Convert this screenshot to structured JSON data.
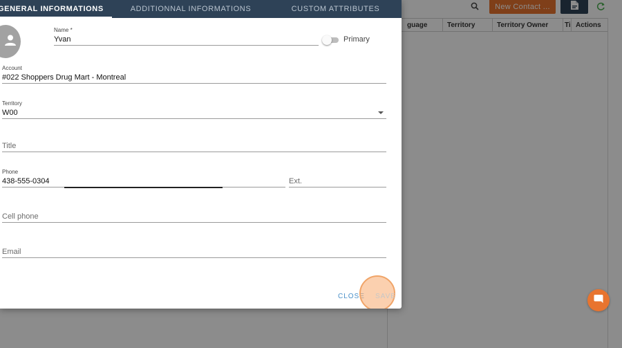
{
  "background": {
    "new_contact_label": "New Contact ...",
    "table_headers": [
      "guage",
      "Territory",
      "Territory Owner",
      "Ti",
      "Actions"
    ]
  },
  "tabs": [
    {
      "label": "GENERAL INFORMATIONS",
      "active": true
    },
    {
      "label": "ADDITIONNAL INFORMATIONS",
      "active": false
    },
    {
      "label": "CUSTOM ATTRIBUTES",
      "active": false
    }
  ],
  "form": {
    "name": {
      "label": "Name *",
      "value": "Yvan"
    },
    "primary": {
      "label": "Primary",
      "checked": false
    },
    "account": {
      "label": "Account",
      "value": "#022 Shoppers Drug Mart - Montreal"
    },
    "territory": {
      "label": "Territory",
      "value": "W00"
    },
    "title": {
      "placeholder": "Title"
    },
    "phone": {
      "label": "Phone",
      "value": "438-555-0304"
    },
    "ext": {
      "placeholder": "Ext."
    },
    "cell_phone": {
      "placeholder": "Cell phone"
    },
    "email": {
      "placeholder": "Email"
    }
  },
  "actions": {
    "close_label": "CLOSE",
    "save_label": "SAVE"
  },
  "colors": {
    "header_bg": "#2e4257",
    "accent_orange": "#e8742f",
    "link_blue": "#4a90c8"
  },
  "icons": [
    "search-icon",
    "file-export-icon",
    "refresh-icon",
    "user-avatar-icon",
    "chevron-down-icon",
    "chat-icon"
  ]
}
